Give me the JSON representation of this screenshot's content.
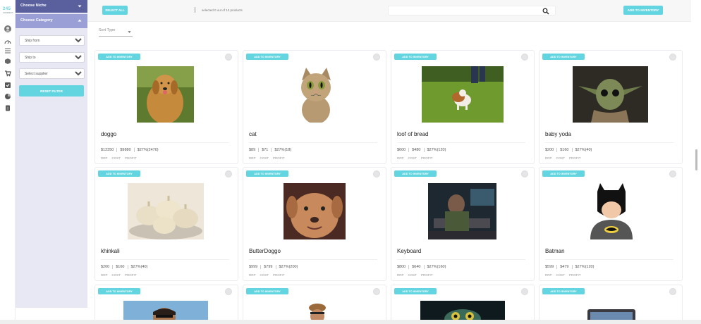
{
  "rail": {
    "logo": "245",
    "logo_sub": "CONNECT",
    "icons": [
      "avatar-icon",
      "gauge-icon",
      "list-icon",
      "box-icon",
      "cart-icon",
      "check-icon",
      "pie-chart-icon",
      "clipboard-icon"
    ]
  },
  "sidebar": {
    "niche_label": "Choose Niche",
    "category_label": "Choose Category",
    "ship_from": "Ship from",
    "ship_to": "Ship to",
    "supplier": "Select supplier",
    "reset_label": "RESET FILTER"
  },
  "topbar": {
    "select_all_label": "SELECT ALL",
    "selected_text": "selected 0 out of 13 products",
    "search_placeholder": "",
    "add_inventory_label": "ADD TO INVENTORY"
  },
  "sort": {
    "label": "Sort Type"
  },
  "card_badge_label": "ADD TO INVENTORY",
  "price_labels": {
    "rrp": "RRP",
    "cost": "COST",
    "profit": "PROFIT"
  },
  "products": [
    {
      "title": "doggo",
      "rrp": "$12350",
      "cost": "$9880",
      "profit": "$27%(2470)"
    },
    {
      "title": "cat",
      "rrp": "$89",
      "cost": "$71",
      "profit": "$27%(18)"
    },
    {
      "title": "loof of bread",
      "rrp": "$600",
      "cost": "$480",
      "profit": "$27%(120)"
    },
    {
      "title": "baby yoda",
      "rrp": "$200",
      "cost": "$160",
      "profit": "$27%(40)"
    },
    {
      "title": "khinkali",
      "rrp": "$200",
      "cost": "$160",
      "profit": "$27%(40)"
    },
    {
      "title": "ButterDoggo",
      "rrp": "$999",
      "cost": "$799",
      "profit": "$27%(200)"
    },
    {
      "title": "Keyboard",
      "rrp": "$800",
      "cost": "$640",
      "profit": "$27%(160)"
    },
    {
      "title": "Batman",
      "rrp": "$599",
      "cost": "$479",
      "profit": "$27%(120)"
    },
    {
      "title": "",
      "rrp": "",
      "cost": "",
      "profit": ""
    },
    {
      "title": "",
      "rrp": "",
      "cost": "",
      "profit": ""
    },
    {
      "title": "",
      "rrp": "",
      "cost": "",
      "profit": ""
    },
    {
      "title": "",
      "rrp": "",
      "cost": "",
      "profit": ""
    }
  ],
  "colors": {
    "accent": "#63d5e0",
    "sidebar_header": "#5a5f9e",
    "sidebar_header2": "#9aa0d6",
    "sidebar_bg": "#e7e8f4"
  }
}
